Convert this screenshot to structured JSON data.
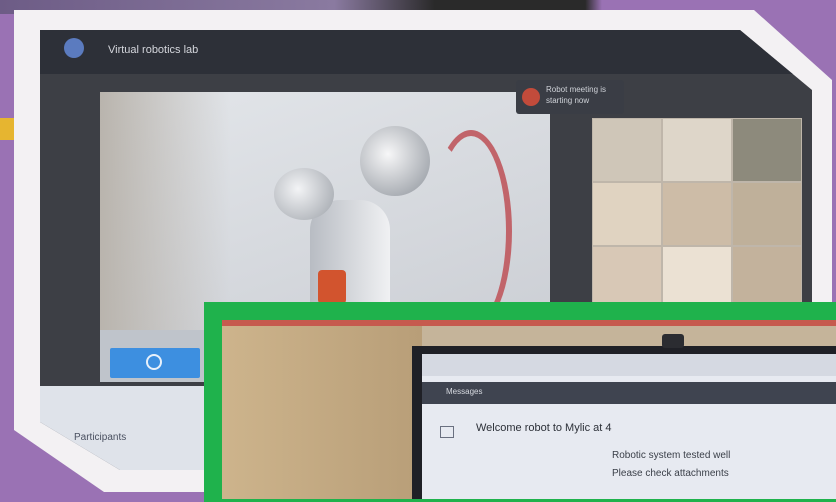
{
  "photo1": {
    "app_title": "Virtual robotics lab",
    "notification": "Robot meeting is starting now",
    "side_label": "Participants"
  },
  "photo2": {
    "toolbar_label": "Messages",
    "subject_line": "Welcome robot to Mylic at 4",
    "line2": "Robotic system tested well",
    "line3": "Please check attachments"
  },
  "colors": {
    "background": "#9a72b4",
    "frame1": "#f3f1f3",
    "frame2": "#1fb24c"
  }
}
